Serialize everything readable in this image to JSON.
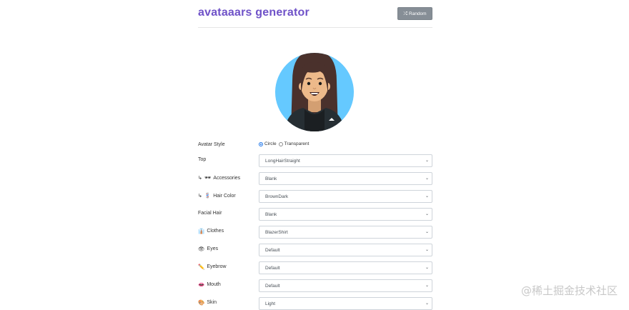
{
  "header": {
    "title": "avataaars generator",
    "random_label": "Random"
  },
  "avatar": {
    "background_color": "#65c9ff",
    "hair_color": "#4a312c",
    "skin_color": "#edb98a",
    "clothes_color": "#262e33"
  },
  "form": {
    "avatar_style": {
      "label": "Avatar Style",
      "options": [
        "Circle",
        "Transparent"
      ],
      "selected": "Circle"
    },
    "rows": [
      {
        "label": "Top",
        "arrow": "",
        "emoji": "",
        "value": "LongHairStraight"
      },
      {
        "label": "Accessories",
        "arrow": "↳",
        "emoji": "🕶",
        "value": "Blank"
      },
      {
        "label": "Hair Color",
        "arrow": "↳",
        "emoji": "💈",
        "value": "BrownDark"
      },
      {
        "label": "Facial Hair",
        "arrow": "",
        "emoji": "",
        "value": "Blank"
      },
      {
        "label": "Clothes",
        "arrow": "",
        "emoji": "👔",
        "value": "BlazerShirt"
      },
      {
        "label": "Eyes",
        "arrow": "",
        "emoji": "👁",
        "value": "Default"
      },
      {
        "label": "Eyebrow",
        "arrow": "",
        "emoji": "✏️",
        "value": "Default"
      },
      {
        "label": "Mouth",
        "arrow": "",
        "emoji": "👄",
        "value": "Default"
      },
      {
        "label": "Skin",
        "arrow": "",
        "emoji": "🎨",
        "value": "Light"
      }
    ]
  },
  "watermark": "@稀土掘金技术社区"
}
